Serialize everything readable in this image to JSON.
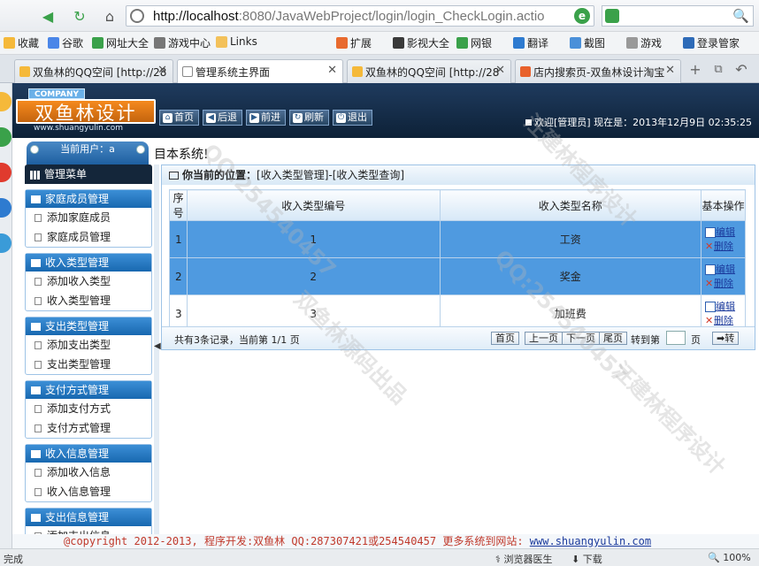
{
  "browser": {
    "url_host": "http://localhost",
    "url_rest": ":8080/JavaWebProject/login/login_CheckLogin.actio",
    "bookmarks": [
      "收藏",
      "谷歌",
      "网址大全",
      "游戏中心",
      "Links",
      "扩展",
      "影视大全",
      "网银",
      "翻译",
      "截图",
      "游戏",
      "登录管家"
    ],
    "tabs": [
      {
        "label": "双鱼林的QQ空间 [http://28"
      },
      {
        "label": "管理系统主界面"
      },
      {
        "label": "双鱼林的QQ空间 [http://28"
      },
      {
        "label": "店内搜索页-双鱼林设计淘宝"
      }
    ],
    "status_left": "完成",
    "status_browser_doctor": "浏览器医生",
    "status_download": "下载",
    "status_zoom": "100%"
  },
  "header": {
    "company": "COMPANY",
    "brand": "双鱼林设计",
    "site": "www.shuangyulin.com",
    "buttons": [
      "首页",
      "后退",
      "前进",
      "刷新",
      "退出"
    ],
    "welcome": "欢迎[管理员]",
    "now_label": "现在是：",
    "datetime": "2013年12月9日 02:35:25"
  },
  "subbar": {
    "current_user": "当前用户：a",
    "marquee": "目本系统!"
  },
  "sidebar": {
    "title": "管理菜单",
    "groups": [
      {
        "title": "家庭成员管理",
        "items": [
          "添加家庭成员",
          "家庭成员管理"
        ]
      },
      {
        "title": "收入类型管理",
        "items": [
          "添加收入类型",
          "收入类型管理"
        ]
      },
      {
        "title": "支出类型管理",
        "items": [
          "添加支出类型",
          "支出类型管理"
        ]
      },
      {
        "title": "支付方式管理",
        "items": [
          "添加支付方式",
          "支付方式管理"
        ]
      },
      {
        "title": "收入信息管理",
        "items": [
          "添加收入信息",
          "收入信息管理"
        ]
      },
      {
        "title": "支出信息管理",
        "items": [
          "添加支出信息"
        ]
      }
    ]
  },
  "content": {
    "location_label": "你当前的位置：",
    "location_path": "[收入类型管理]-[收入类型查询]",
    "columns": [
      "序号",
      "收入类型编号",
      "收入类型名称",
      "基本操作"
    ],
    "rows": [
      {
        "no": "1",
        "code": "1",
        "name": "工资"
      },
      {
        "no": "2",
        "code": "2",
        "name": "奖金"
      },
      {
        "no": "3",
        "code": "3",
        "name": "加班费"
      }
    ],
    "edit_label": "编辑",
    "delete_label": "删除",
    "pager": {
      "total": "共有3条记录，当前第 1/1 页",
      "first": "首页",
      "prev": "上一页",
      "next": "下一页",
      "last": "尾页",
      "jump_label": "转到第",
      "page_unit": "页",
      "go": "转"
    }
  },
  "footer": {
    "text": "@copyright 2012-2013, 程序开发:双鱼林  QQ:287307421或254540457  更多系统到网站:",
    "link": "www.shuangyulin.com"
  },
  "watermarks": [
    "QQ:254540457",
    "汪建林程序设计",
    "双鱼林源码出品",
    "QQ:254540457",
    "汪建林程序设计"
  ]
}
